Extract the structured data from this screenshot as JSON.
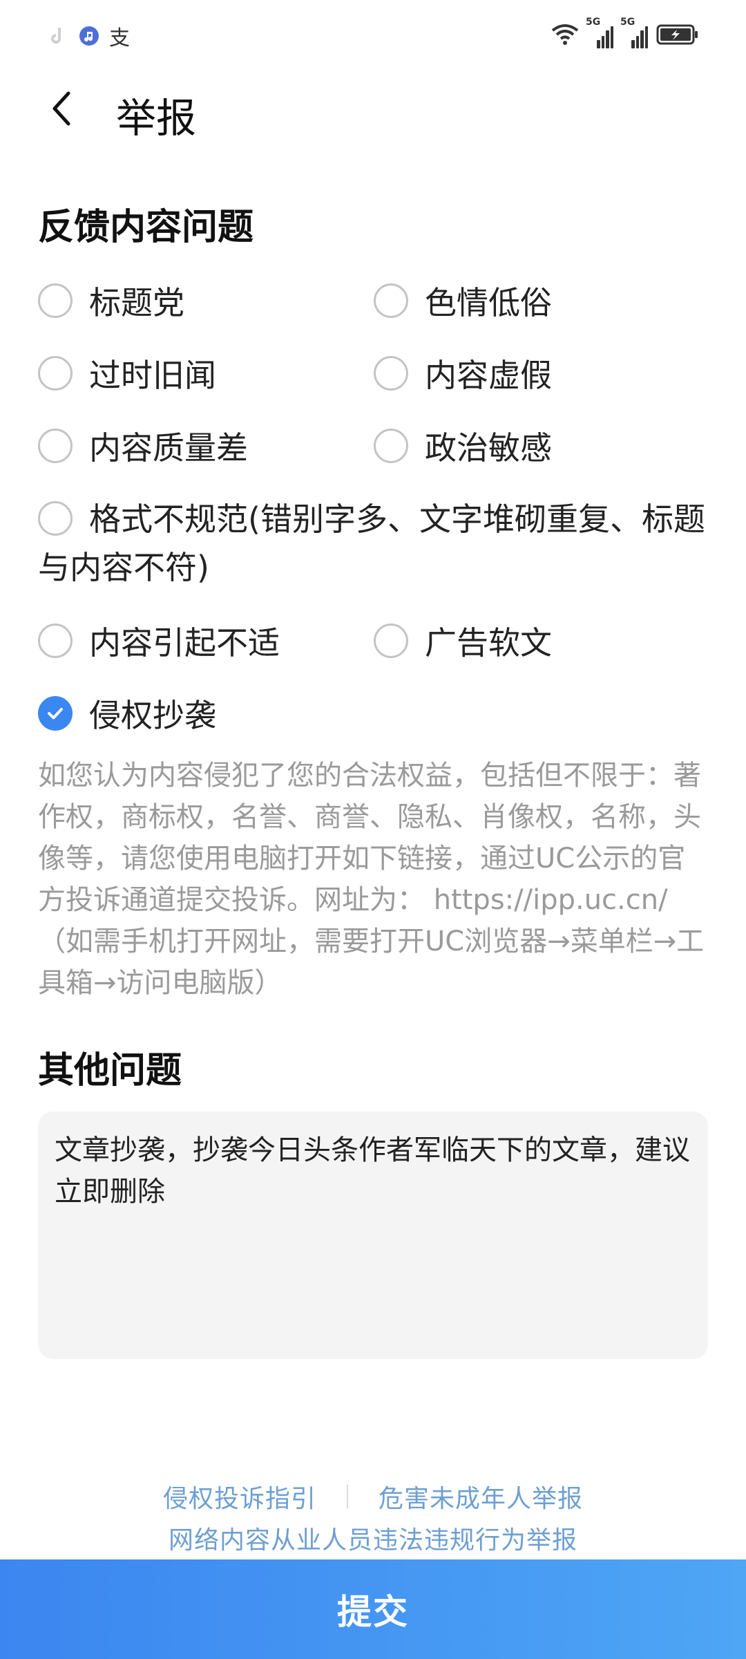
{
  "status_bar": {
    "left_icons": [
      "tiktok-icon",
      "music-icon",
      "alipay-icon"
    ],
    "alipay_glyph": "支",
    "signal_label_1": "5G",
    "signal_label_2": "5G"
  },
  "header": {
    "title": "举报"
  },
  "section1": {
    "title": "反馈内容问题"
  },
  "options": {
    "clickbait": "标题党",
    "pornographic": "色情低俗",
    "outdated": "过时旧闻",
    "false_content": "内容虚假",
    "low_quality": "内容质量差",
    "political": "政治敏感",
    "format_issue": "格式不规范(错别字多、文字堆砌重复、标题与内容不符)",
    "discomfort": "内容引起不适",
    "ad": "广告软文",
    "infringement": "侵权抄袭"
  },
  "description": "如您认为内容侵犯了您的合法权益，包括但不限于：著作权，商标权，名誉、商誉、隐私、肖像权，名称，头像等，请您使用电脑打开如下链接，通过UC公示的官方投诉通道提交投诉。网址为： https://ipp.uc.cn/（如需手机打开网址，需要打开UC浏览器→菜单栏→工具箱→访问电脑版）",
  "section2": {
    "title": "其他问题"
  },
  "textarea": {
    "value": "文章抄袭，抄袭今日头条作者军临天下的文章，建议立即删除"
  },
  "footer": {
    "link1": "侵权投诉指引",
    "link2": "危害未成年人举报",
    "link3": "网络内容从业人员违法违规行为举报"
  },
  "submit": {
    "label": "提交"
  },
  "colors": {
    "accent": "#3a87f0",
    "link": "#6e9fd2",
    "muted": "#9a9a9a"
  }
}
